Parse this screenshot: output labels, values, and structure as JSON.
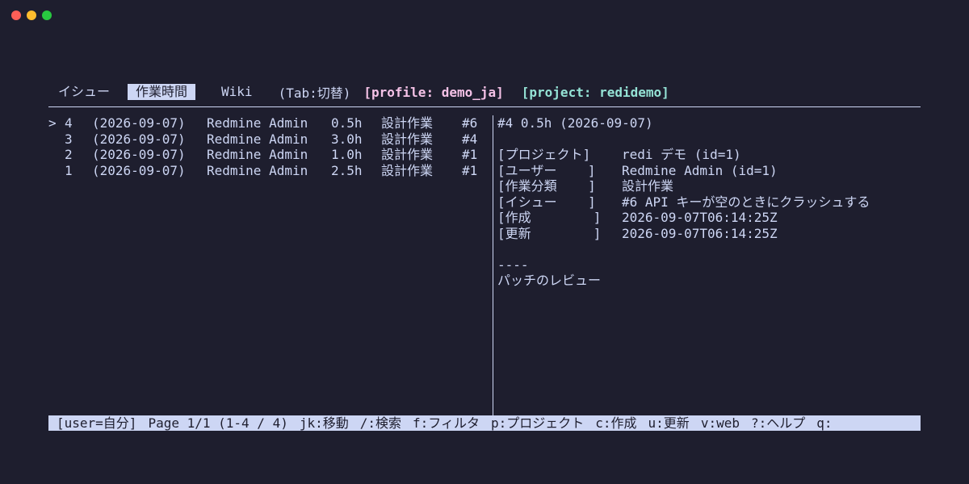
{
  "tabs": [
    {
      "label": "イシュー",
      "active": false
    },
    {
      "label": "作業時間",
      "active": true
    },
    {
      "label": "Wiki",
      "active": false
    }
  ],
  "tab_hint": "(Tab:切替)",
  "profile": "[profile: demo_ja]",
  "project": "[project: redidemo]",
  "colors": {
    "background": "#1e1e2e",
    "foreground": "#cdd6f4",
    "profile": "#f5c2e7",
    "project": "#94e2d5"
  },
  "entries": [
    {
      "marker": ">",
      "id": "4",
      "date": "(2026-09-07)",
      "user": "Redmine Admin",
      "hours": "0.5h",
      "activity": "設計作業",
      "issue": "#6"
    },
    {
      "marker": "",
      "id": "3",
      "date": "(2026-09-07)",
      "user": "Redmine Admin",
      "hours": "3.0h",
      "activity": "設計作業",
      "issue": "#4"
    },
    {
      "marker": "",
      "id": "2",
      "date": "(2026-09-07)",
      "user": "Redmine Admin",
      "hours": "1.0h",
      "activity": "設計作業",
      "issue": "#1"
    },
    {
      "marker": "",
      "id": "1",
      "date": "(2026-09-07)",
      "user": "Redmine Admin",
      "hours": "2.5h",
      "activity": "設計作業",
      "issue": "#1"
    }
  ],
  "detail": {
    "header": "#4 0.5h (2026-09-07)",
    "fields": [
      {
        "label": "[プロジェクト]",
        "value": "redi デモ (id=1)"
      },
      {
        "label": "[ユーザー    ]",
        "value": "Redmine Admin (id=1)"
      },
      {
        "label": "[作業分類    ]",
        "value": "設計作業"
      },
      {
        "label": "[イシュー    ]",
        "value": "#6 API キーが空のときにクラッシュする"
      },
      {
        "label": "[作成        ]",
        "value": "2026-09-07T06:14:25Z"
      },
      {
        "label": "[更新        ]",
        "value": "2026-09-07T06:14:25Z"
      }
    ],
    "separator": "----",
    "comment": "パッチのレビュー"
  },
  "status_bar": {
    "user_filter": "[user=自分]",
    "page": "Page 1/1 (1-4 / 4)",
    "keys": [
      "jk:移動",
      "/:検索",
      "f:フィルタ",
      "p:プロジェクト",
      "c:作成",
      "u:更新",
      "v:web",
      "?:ヘルプ",
      "q:"
    ]
  }
}
